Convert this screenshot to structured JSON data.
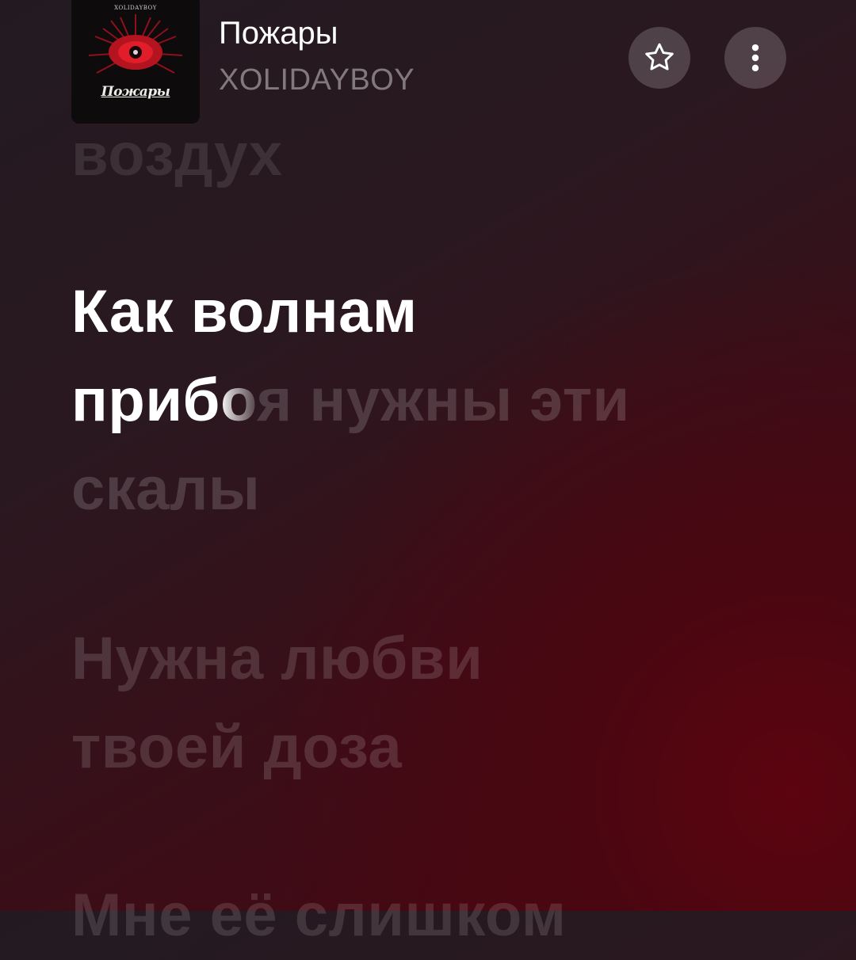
{
  "track": {
    "title": "Пожары",
    "artist": "XOLIDAYBOY",
    "cover": {
      "top_text": "XOLIDAYBOY",
      "title": "Пожары"
    }
  },
  "buttons": {
    "favorite_icon": "star-outline-icon",
    "more_icon": "vertical-dots-icon"
  },
  "lyrics": {
    "previous": "воздух",
    "active_line_1": "Как волнам",
    "active_line_2_sung": "приб",
    "active_line_2_partial": "о",
    "active_line_2_unsung": "я нужны эти",
    "active_line_3": "скалы",
    "next_line_1": "Нужна любви",
    "next_line_2": "твоей доза",
    "next_line_3": "Мне её слишком"
  },
  "colors": {
    "accent": "#5c0410",
    "text_active": "#ffffff"
  }
}
